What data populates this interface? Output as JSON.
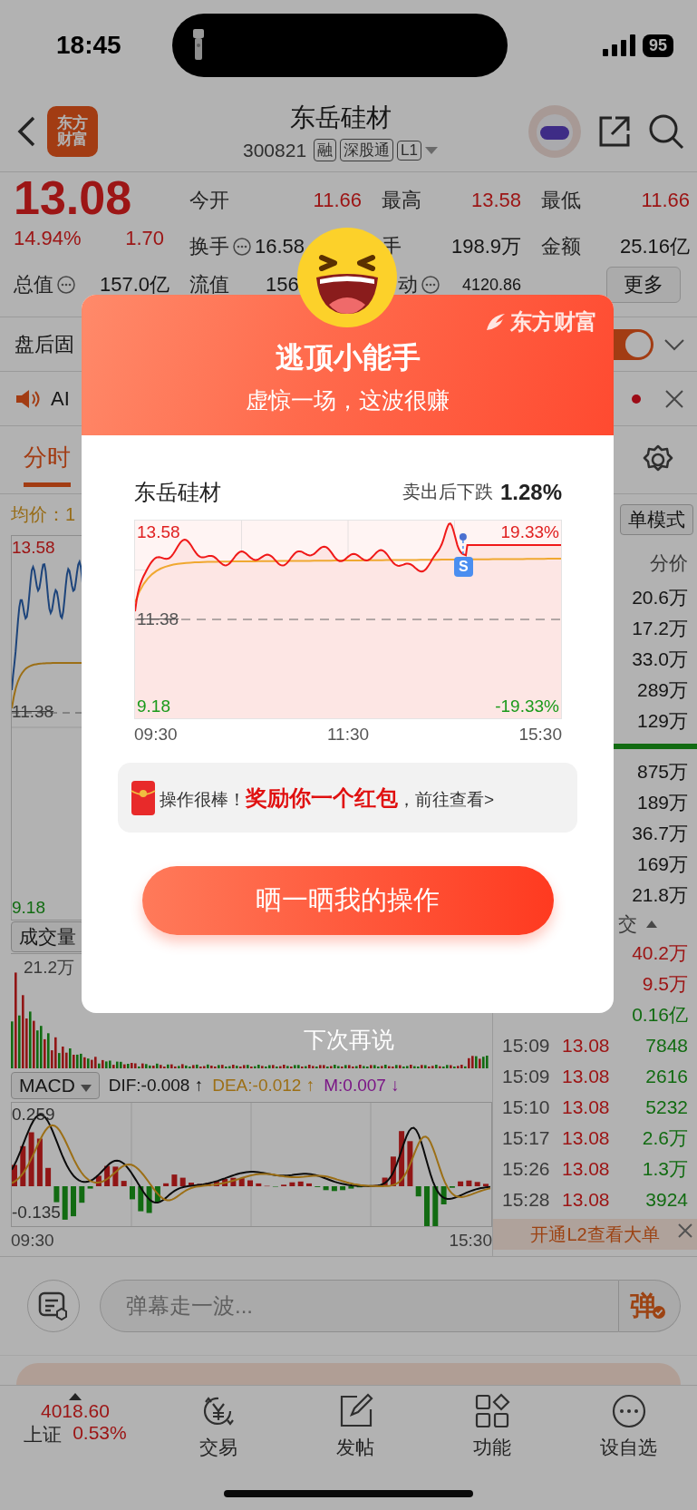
{
  "status_bar": {
    "time": "18:45",
    "battery": "95"
  },
  "header": {
    "logo_lines": [
      "东方",
      "财富"
    ],
    "title": "东岳硅材",
    "code": "300821",
    "tags": [
      "融",
      "深股通",
      "L1"
    ]
  },
  "quote": {
    "price": "13.08",
    "change_pct": "14.94%",
    "change": "1.70",
    "fields": [
      {
        "label": "今开",
        "value": "11.66",
        "kind": "rise",
        "info": false
      },
      {
        "label": "最高",
        "value": "13.58",
        "kind": "rise",
        "info": false
      },
      {
        "label": "最低",
        "value": "11.66",
        "kind": "rise",
        "info": false
      },
      {
        "label": "换手",
        "value": "16.58",
        "kind": "plain",
        "info": true
      },
      {
        "label": "手",
        "value": "198.9万",
        "kind": "plain",
        "info": false
      },
      {
        "label": "金额",
        "value": "25.16亿",
        "kind": "plain",
        "info": false
      },
      {
        "label": "总值",
        "value": "157.0亿",
        "kind": "plain",
        "info": true
      },
      {
        "label": "流值",
        "value": "156",
        "kind": "plain",
        "info": false
      },
      {
        "label": "动",
        "value": "4120.86",
        "kind": "plain",
        "info": true
      }
    ],
    "more_button": "更多"
  },
  "notices": [
    {
      "kind": "toggle",
      "label": "盘后固",
      "on": true
    },
    {
      "kind": "alert",
      "label": "AI"
    }
  ],
  "chart_tabs": [
    {
      "label": "分时",
      "selected": true
    }
  ],
  "intraday": {
    "avg_label": "均价：1",
    "price_labels": [
      {
        "text": "13.58",
        "kind": "high"
      },
      {
        "text": "11.38",
        "kind": "base"
      },
      {
        "text": "9.18",
        "kind": "low"
      }
    ],
    "volume_button": "成交量",
    "volume_max": "21.2万",
    "indicator_button": "MACD",
    "indicator_values": [
      {
        "text": "DIF:-0.008 ↑",
        "kind": "dif"
      },
      {
        "text": "DEA:-0.012 ↑",
        "kind": "dea"
      },
      {
        "text": "M:0.007 ↓",
        "kind": "m"
      }
    ],
    "macd_labels": [
      "0.259",
      "-0.135"
    ],
    "times": [
      "09:30",
      "15:30"
    ]
  },
  "order_book": {
    "mode_button": "单模式",
    "header": "分价",
    "upper_volumes": [
      "20.6万",
      "17.2万",
      "33.0万",
      "289万",
      "129万"
    ],
    "lower_volumes": [
      "875万",
      "189万",
      "36.7万",
      "169万",
      "21.8万"
    ]
  },
  "trades": {
    "header": "交",
    "rows": [
      {
        "volume": "40.2万",
        "kind": "buy"
      },
      {
        "volume": "9.5万",
        "kind": "buy"
      },
      {
        "volume": "0.16亿",
        "kind": "sell"
      },
      {
        "time": "15:09",
        "price": "13.08",
        "volume": "7848",
        "kind": "sell"
      },
      {
        "time": "15:09",
        "price": "13.08",
        "volume": "2616",
        "kind": "sell"
      },
      {
        "time": "15:10",
        "price": "13.08",
        "volume": "5232",
        "kind": "sell"
      },
      {
        "time": "15:17",
        "price": "13.08",
        "volume": "2.6万",
        "kind": "sell"
      },
      {
        "time": "15:26",
        "price": "13.08",
        "volume": "1.3万",
        "kind": "sell"
      },
      {
        "time": "15:28",
        "price": "13.08",
        "volume": "3924",
        "kind": "sell"
      }
    ],
    "l2_banner": "开通L2查看大单"
  },
  "comment_bar": {
    "placeholder": "弹幕走一波...",
    "send_button": "弹"
  },
  "bottom_nav": {
    "index": {
      "value": "4018.60",
      "name": "上证",
      "change": "0.53%"
    },
    "items": [
      {
        "label": "交易",
        "kind": "trade"
      },
      {
        "label": "发帖",
        "kind": "post"
      },
      {
        "label": "功能",
        "kind": "apps"
      },
      {
        "label": "设自选",
        "kind": "more"
      }
    ]
  },
  "popup": {
    "brand": "东方财富",
    "title": "逃顶小能手",
    "subtitle": "虚惊一场，这波很赚",
    "stock": "东岳硅材",
    "result_label": "卖出后下跌",
    "result_value": "1.28%",
    "chart": {
      "top_price": "13.58",
      "top_pct": "19.33%",
      "mid_price": "11.38",
      "bottom_price": "9.18",
      "bottom_pct": "-19.33%",
      "times": [
        "09:30",
        "11:30",
        "15:30"
      ],
      "marker": "S"
    },
    "reward": "操作很棒！**奖励你一个红包**，前往查看>",
    "share_button": "晒一晒我的操作",
    "dismiss": "下次再说"
  }
}
